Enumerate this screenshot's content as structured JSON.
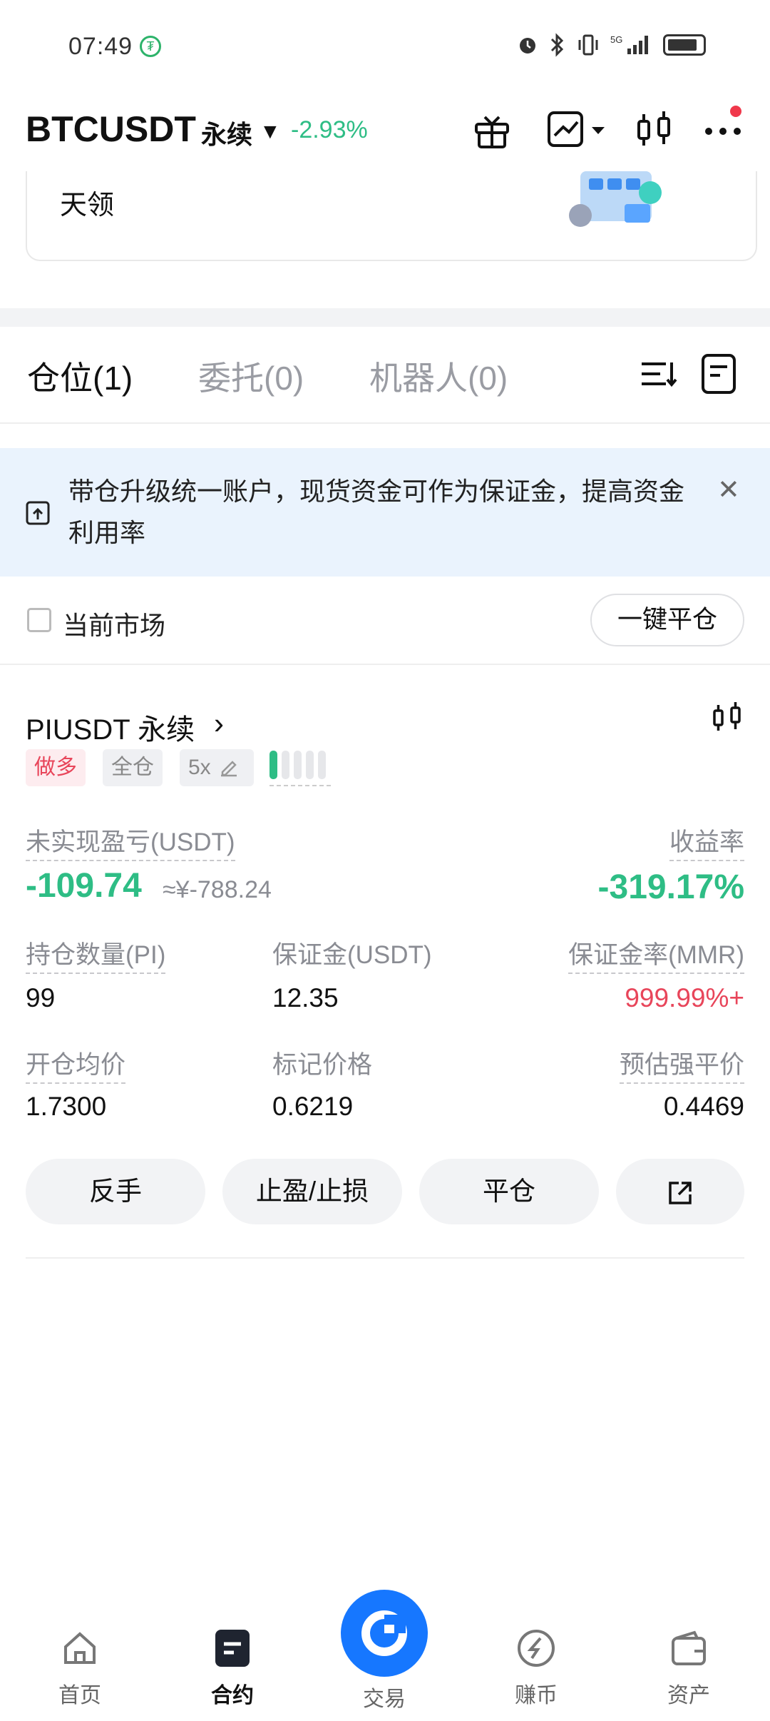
{
  "status_bar": {
    "time": "07:49",
    "icons": [
      "alarm-icon",
      "bluetooth-icon",
      "vibrate-icon",
      "5g-signal-icon",
      "battery-icon"
    ]
  },
  "header": {
    "symbol": "BTCUSDT",
    "contract_type": "永续",
    "change_pct": "-2.93%",
    "change_color": "#2ebd85",
    "icons": [
      "gift-icon",
      "chart-trend-icon",
      "candlestick-icon",
      "more-icon"
    ]
  },
  "promo": {
    "text": "天领"
  },
  "tabs": [
    {
      "label": "仓位(1)",
      "active": true
    },
    {
      "label": "委托(0)",
      "active": false
    },
    {
      "label": "机器人(0)",
      "active": false
    }
  ],
  "notice": {
    "text": "带仓升级统一账户，现货资金可作为保证金，提高资金利用率"
  },
  "filter": {
    "current_market_label": "当前市场",
    "checked": false,
    "close_all_label": "一键平仓"
  },
  "position": {
    "title": "PIUSDT 永续",
    "tags": {
      "side": "做多",
      "margin_mode": "全仓",
      "leverage": "5x"
    },
    "risk_level": 1,
    "risk_total": 5,
    "unrealized_pnl_label": "未实现盈亏(USDT)",
    "unrealized_pnl": "-109.74",
    "unrealized_pnl_cny": "≈¥-788.24",
    "roe_label": "收益率",
    "roe": "-319.17%",
    "size_label": "持仓数量(PI)",
    "size": "99",
    "margin_label": "保证金(USDT)",
    "margin": "12.35",
    "mmr_label": "保证金率(MMR)",
    "mmr": "999.99%+",
    "entry_label": "开仓均价",
    "entry": "1.7300",
    "mark_label": "标记价格",
    "mark": "0.6219",
    "liq_label": "预估强平价",
    "liq": "0.4469",
    "actions": {
      "reverse": "反手",
      "tpsl": "止盈/止损",
      "close": "平仓"
    }
  },
  "bottom_nav": [
    {
      "label": "首页",
      "icon": "home-icon"
    },
    {
      "label": "合约",
      "icon": "contract-icon",
      "active": true
    },
    {
      "label": "交易",
      "icon": "trade-icon"
    },
    {
      "label": "赚币",
      "icon": "earn-icon"
    },
    {
      "label": "资产",
      "icon": "wallet-icon"
    }
  ],
  "colors": {
    "up_green": "#2ebd85",
    "down_red": "#e8455a",
    "brand_blue": "#1677ff"
  }
}
